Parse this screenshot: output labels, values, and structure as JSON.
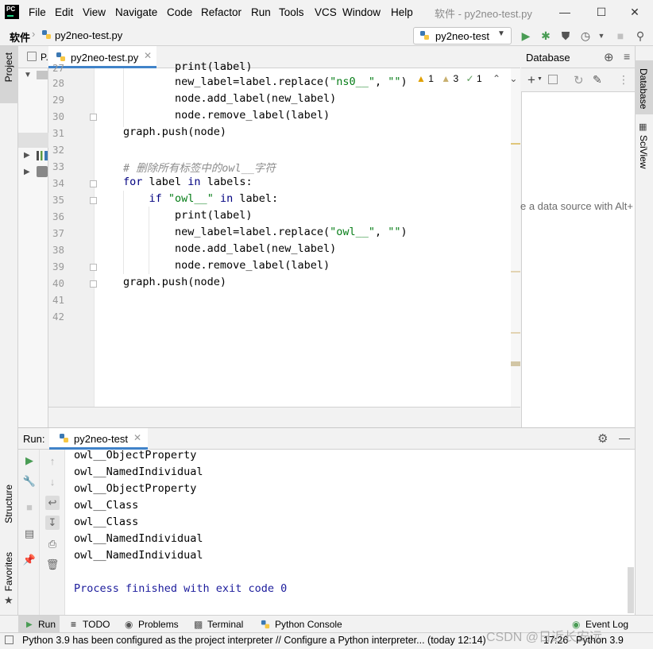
{
  "app": {
    "logo_text": "PC",
    "window_title": "软件 - py2neo-test.py"
  },
  "menu": [
    "File",
    "Edit",
    "View",
    "Navigate",
    "Code",
    "Refactor",
    "Run",
    "Tools",
    "VCS",
    "Window",
    "Help"
  ],
  "navbar": {
    "project": "软件",
    "file": "py2neo-test.py",
    "run_config": "py2neo-test"
  },
  "left_stripe": {
    "project": "Project",
    "structure": "Structure",
    "favorites": "Favorites"
  },
  "project_panel": {
    "title_fragment": "P."
  },
  "editor": {
    "tab_label": "py2neo-test.py",
    "inspections": {
      "warnings": "1",
      "weak_warnings": "3",
      "typos": "1"
    },
    "lines": [
      {
        "n": "27",
        "code": "        print(label)"
      },
      {
        "n": "28",
        "code": "        new_label=label.replace(\"ns0__\", \"\")"
      },
      {
        "n": "29",
        "code": "        node.add_label(new_label)"
      },
      {
        "n": "30",
        "code": "        node.remove_label(label)"
      },
      {
        "n": "31",
        "code": "graph.push(node)"
      },
      {
        "n": "32",
        "code": ""
      },
      {
        "n": "33",
        "code": "# 删除所有标签中的owl__字符"
      },
      {
        "n": "34",
        "code": "for label in labels:"
      },
      {
        "n": "35",
        "code": "    if \"owl__\" in label:"
      },
      {
        "n": "36",
        "code": "        print(label)"
      },
      {
        "n": "37",
        "code": "        new_label=label.replace(\"owl__\", \"\")"
      },
      {
        "n": "38",
        "code": "        node.add_label(new_label)"
      },
      {
        "n": "39",
        "code": "        node.remove_label(label)"
      },
      {
        "n": "40",
        "code": "graph.push(node)"
      },
      {
        "n": "41",
        "code": ""
      },
      {
        "n": "42",
        "code": ""
      }
    ]
  },
  "database": {
    "title": "Database",
    "hint": "e a data source with Alt+"
  },
  "right_stripe": {
    "database": "Database",
    "sciview": "SciView"
  },
  "run": {
    "label": "Run:",
    "tab": "py2neo-test",
    "output": [
      "owl__ObjectProperty",
      "owl__NamedIndividual",
      "owl__ObjectProperty",
      "owl__Class",
      "owl__Class",
      "owl__NamedIndividual",
      "owl__NamedIndividual",
      "",
      "Process finished with exit code 0"
    ]
  },
  "bottom_tabs": [
    "Run",
    "TODO",
    "Problems",
    "Terminal",
    "Python Console",
    "Event Log"
  ],
  "status": {
    "message": "Python 3.9 has been configured as the project interpreter // Configure a Python interpreter... (today 12:14)",
    "position": "17:26",
    "interpreter": "Python 3.9"
  },
  "watermark": "CSDN @日近长安远",
  "colors": {
    "accent": "#4083c9",
    "keyword": "#000080",
    "string": "#067d17",
    "comment": "#8c8c8c",
    "run_green": "#499c54"
  }
}
